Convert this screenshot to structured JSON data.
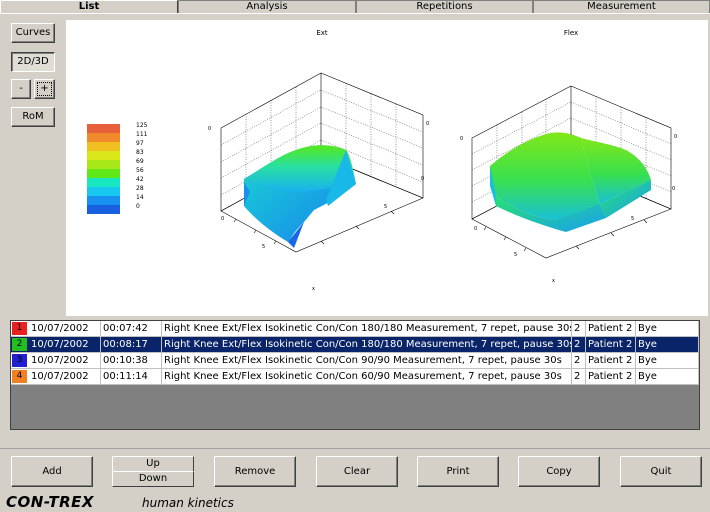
{
  "tabs": [
    "List",
    "Analysis",
    "Repetitions",
    "Measurement"
  ],
  "side_buttons": {
    "curves": "Curves",
    "view_2d3d": "2D/3D",
    "zoom_out": "-",
    "zoom_in": "+",
    "rom": "RoM"
  },
  "charts": {
    "left_title": "Ext",
    "right_title": "Flex"
  },
  "legend": {
    "ticks": [
      "125",
      "111",
      "97",
      "83",
      "69",
      "56",
      "42",
      "28",
      "14",
      "0"
    ],
    "colors": [
      "#e8603a",
      "#f08a2a",
      "#f0c020",
      "#d8e81a",
      "#a8e818",
      "#60e818",
      "#18e8c0",
      "#18c8f0",
      "#1890f0",
      "#1860e0"
    ]
  },
  "measurements": [
    {
      "num": "1",
      "color": "#e82020",
      "date": "10/07/2002",
      "time": "00:07:42",
      "desc": "Right Knee Ext/Flex Isokinetic Con/Con 180/180 Measurement, 7 repet, pause 30s",
      "id": "2",
      "patient": "Patient 2",
      "doctor": "Bye",
      "selected": false
    },
    {
      "num": "2",
      "color": "#20c020",
      "date": "10/07/2002",
      "time": "00:08:17",
      "desc": "Right Knee Ext/Flex Isokinetic Con/Con 180/180 Measurement, 7 repet, pause 30s",
      "id": "2",
      "patient": "Patient 2",
      "doctor": "Bye",
      "selected": true
    },
    {
      "num": "3",
      "color": "#2020d0",
      "date": "10/07/2002",
      "time": "00:10:38",
      "desc": "Right Knee Ext/Flex Isokinetic Con/Con 90/90 Measurement, 7 repet, pause 30s",
      "id": "2",
      "patient": "Patient 2",
      "doctor": "Bye",
      "selected": false
    },
    {
      "num": "4",
      "color": "#f08020",
      "date": "10/07/2002",
      "time": "00:11:14",
      "desc": "Right Knee Ext/Flex Isokinetic Con/Con 60/90 Measurement, 7 repet, pause 30s",
      "id": "2",
      "patient": "Patient 2",
      "doctor": "Bye",
      "selected": false
    }
  ],
  "bottom_buttons": {
    "add": "Add",
    "up": "Up",
    "down": "Down",
    "remove": "Remove",
    "clear": "Clear",
    "print": "Print",
    "copy": "Copy",
    "quit": "Quit"
  },
  "brand": {
    "name": "CON-TREX",
    "tagline": "human kinetics"
  }
}
